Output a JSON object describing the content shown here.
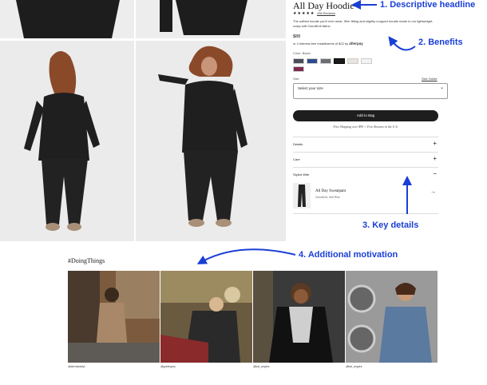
{
  "product": {
    "title": "All Day Hoodie",
    "stars": "★★★★★",
    "reviews": "436 Reviews",
    "description": "The softest hoodie you'll ever wear. Slim fitting and slightly cropped hoodie made in our lightweight, crazy soft CloudKnit fabric.",
    "price": "$88",
    "afterpay_text": "or 4 interest-free installments of $22 by",
    "afterpay_brand": "afterpay",
    "color_label": "Color: Black",
    "size_label": "Size",
    "size_guide": "Size Guide",
    "size_placeholder": "Select your size",
    "add_to_bag": "Add to Bag",
    "shipping": "Free Shipping over $99 + Free Returns in the U.S.",
    "accordion": [
      "Details",
      "Care",
      "Styled With"
    ],
    "accordion_signs": [
      "+",
      "+",
      "−"
    ],
    "styled_item": "All Day Sweatpant",
    "styled_sub": "CloudKnit, Mid Rise",
    "styled_arrow": "→",
    "chevron": "⌄",
    "swatch_colors": [
      "#4a4e5a",
      "#2f4a8c",
      "#6b6e74",
      "#1c1c1c",
      "#e9e4de",
      "#f2f2f2",
      "#7e2a4e"
    ]
  },
  "annotations": {
    "a1": "1. Descriptive headline",
    "a2": "2. Benefits",
    "a3": "3. Key details",
    "a4": "4. Additional motivation",
    "arrow_color": "#1a3fd6"
  },
  "ugc": {
    "hashtag": "#DoingThings",
    "handles": [
      "@alexiskadiyl",
      "@goldegrey",
      "@kat_angles",
      "@kat_angles"
    ]
  }
}
